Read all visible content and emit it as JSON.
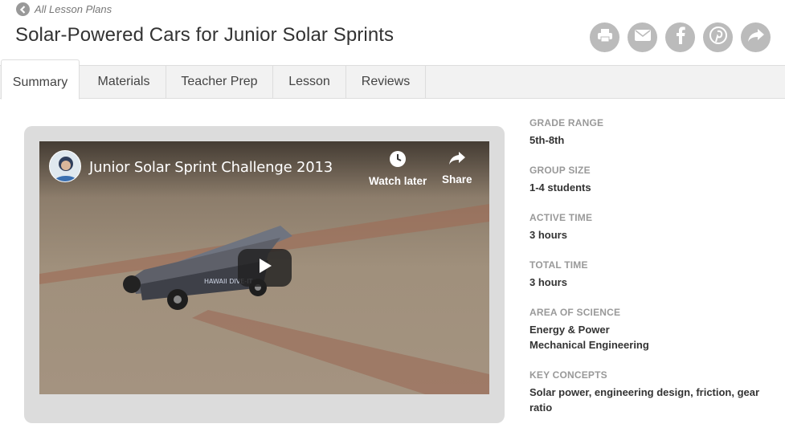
{
  "breadcrumb": {
    "back_label": "All Lesson Plans"
  },
  "page": {
    "title": "Solar-Powered Cars for Junior Solar Sprints"
  },
  "share": {
    "icons": [
      "print-icon",
      "email-icon",
      "facebook-icon",
      "pinterest-icon",
      "share-icon"
    ]
  },
  "tabs": [
    {
      "label": "Summary",
      "active": true
    },
    {
      "label": "Materials",
      "active": false
    },
    {
      "label": "Teacher Prep",
      "active": false
    },
    {
      "label": "Lesson",
      "active": false
    },
    {
      "label": "Reviews",
      "active": false
    }
  ],
  "video": {
    "title": "Junior Solar Sprint Challenge 2013",
    "watch_later_label": "Watch later",
    "share_label": "Share",
    "car_text": "HAWAII DIVE-IT"
  },
  "sidebar": {
    "grade_range": {
      "label": "GRADE RANGE",
      "value": "5th-8th"
    },
    "group_size": {
      "label": "GROUP SIZE",
      "value": "1-4 students"
    },
    "active_time": {
      "label": "ACTIVE TIME",
      "value": "3 hours"
    },
    "total_time": {
      "label": "TOTAL TIME",
      "value": "3 hours"
    },
    "area_of_science": {
      "label": "AREA OF SCIENCE",
      "values": [
        "Energy & Power",
        "Mechanical Engineering"
      ]
    },
    "key_concepts": {
      "label": "KEY CONCEPTS",
      "value": "Solar power, engineering design, friction, gear ratio"
    }
  },
  "colors": {
    "icon_bg": "#bbbbbb",
    "tab_bg": "#f2f2f2",
    "label_gray": "#999999"
  }
}
